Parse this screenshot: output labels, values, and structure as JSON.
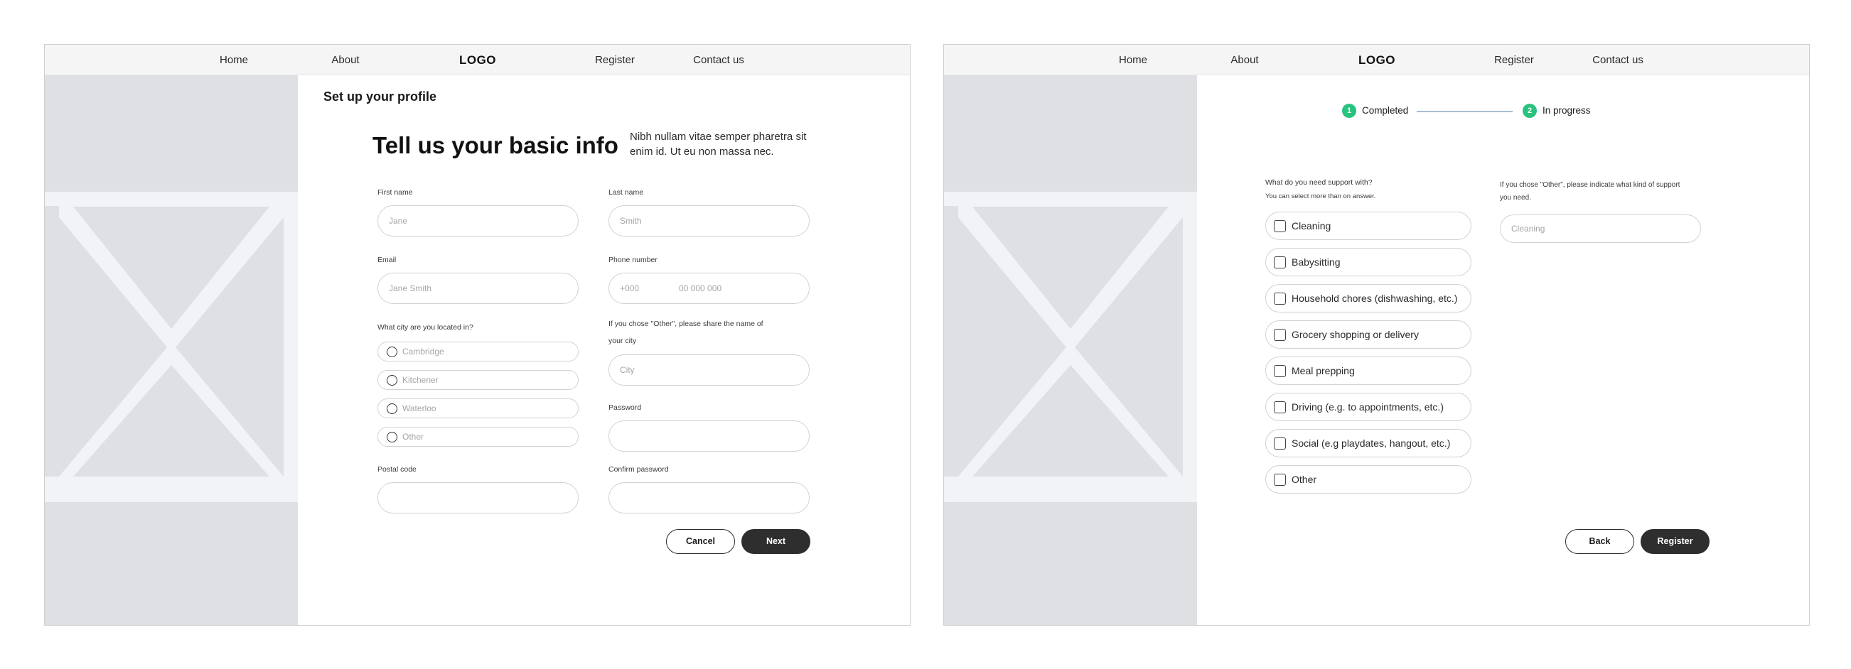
{
  "nav": {
    "home": "Home",
    "about": "About",
    "logo": "LOGO",
    "register": "Register",
    "contact": "Contact us"
  },
  "screen1": {
    "section_title": "Set up your profile",
    "hero_title": "Tell us your basic info",
    "hero_description": "Nibh nullam vitae semper pharetra sit enim id. Ut eu non massa nec.",
    "first_name": {
      "label": "First name",
      "placeholder": "Jane"
    },
    "last_name": {
      "label": "Last name",
      "placeholder": "Smith"
    },
    "email": {
      "label": "Email",
      "placeholder": "Jane Smith"
    },
    "phone": {
      "label": "Phone number",
      "code_placeholder": "+000",
      "number_placeholder": "00 000 000"
    },
    "city_question": "What city are you located in?",
    "city_options": [
      "Cambridge",
      "Kitchener",
      "Waterloo",
      "Other"
    ],
    "other_city": {
      "label": "If you chose \"Other\", please share the name of your city",
      "placeholder": "City"
    },
    "password": {
      "label": "Password",
      "placeholder": ""
    },
    "postal_code": {
      "label": "Postal code",
      "placeholder": ""
    },
    "confirm_password": {
      "label": "Confirm password",
      "placeholder": ""
    },
    "cancel_label": "Cancel",
    "next_label": "Next"
  },
  "screen2": {
    "steps": [
      {
        "number": "1",
        "label": "Completed"
      },
      {
        "number": "2",
        "label": "In progress"
      }
    ],
    "support_question": "What do you need support with?",
    "support_hint": "You can select more than on answer.",
    "support_options": [
      "Cleaning",
      "Babysitting",
      "Household chores (dishwashing, etc.)",
      "Grocery shopping or delivery",
      "Meal prepping",
      "Driving (e.g. to appointments, etc.)",
      "Social (e.g playdates, hangout, etc.)",
      "Other"
    ],
    "other_support": {
      "label": "If you chose \"Other\", please indicate what kind of support you need.",
      "placeholder": "Cleaning"
    },
    "back_label": "Back",
    "register_label": "Register"
  },
  "colors": {
    "step_green": "#29c27f",
    "button_dark": "#2e2e2e",
    "placeholder_gray": "#dfe0e3",
    "nav_bg": "#f5f5f5"
  }
}
